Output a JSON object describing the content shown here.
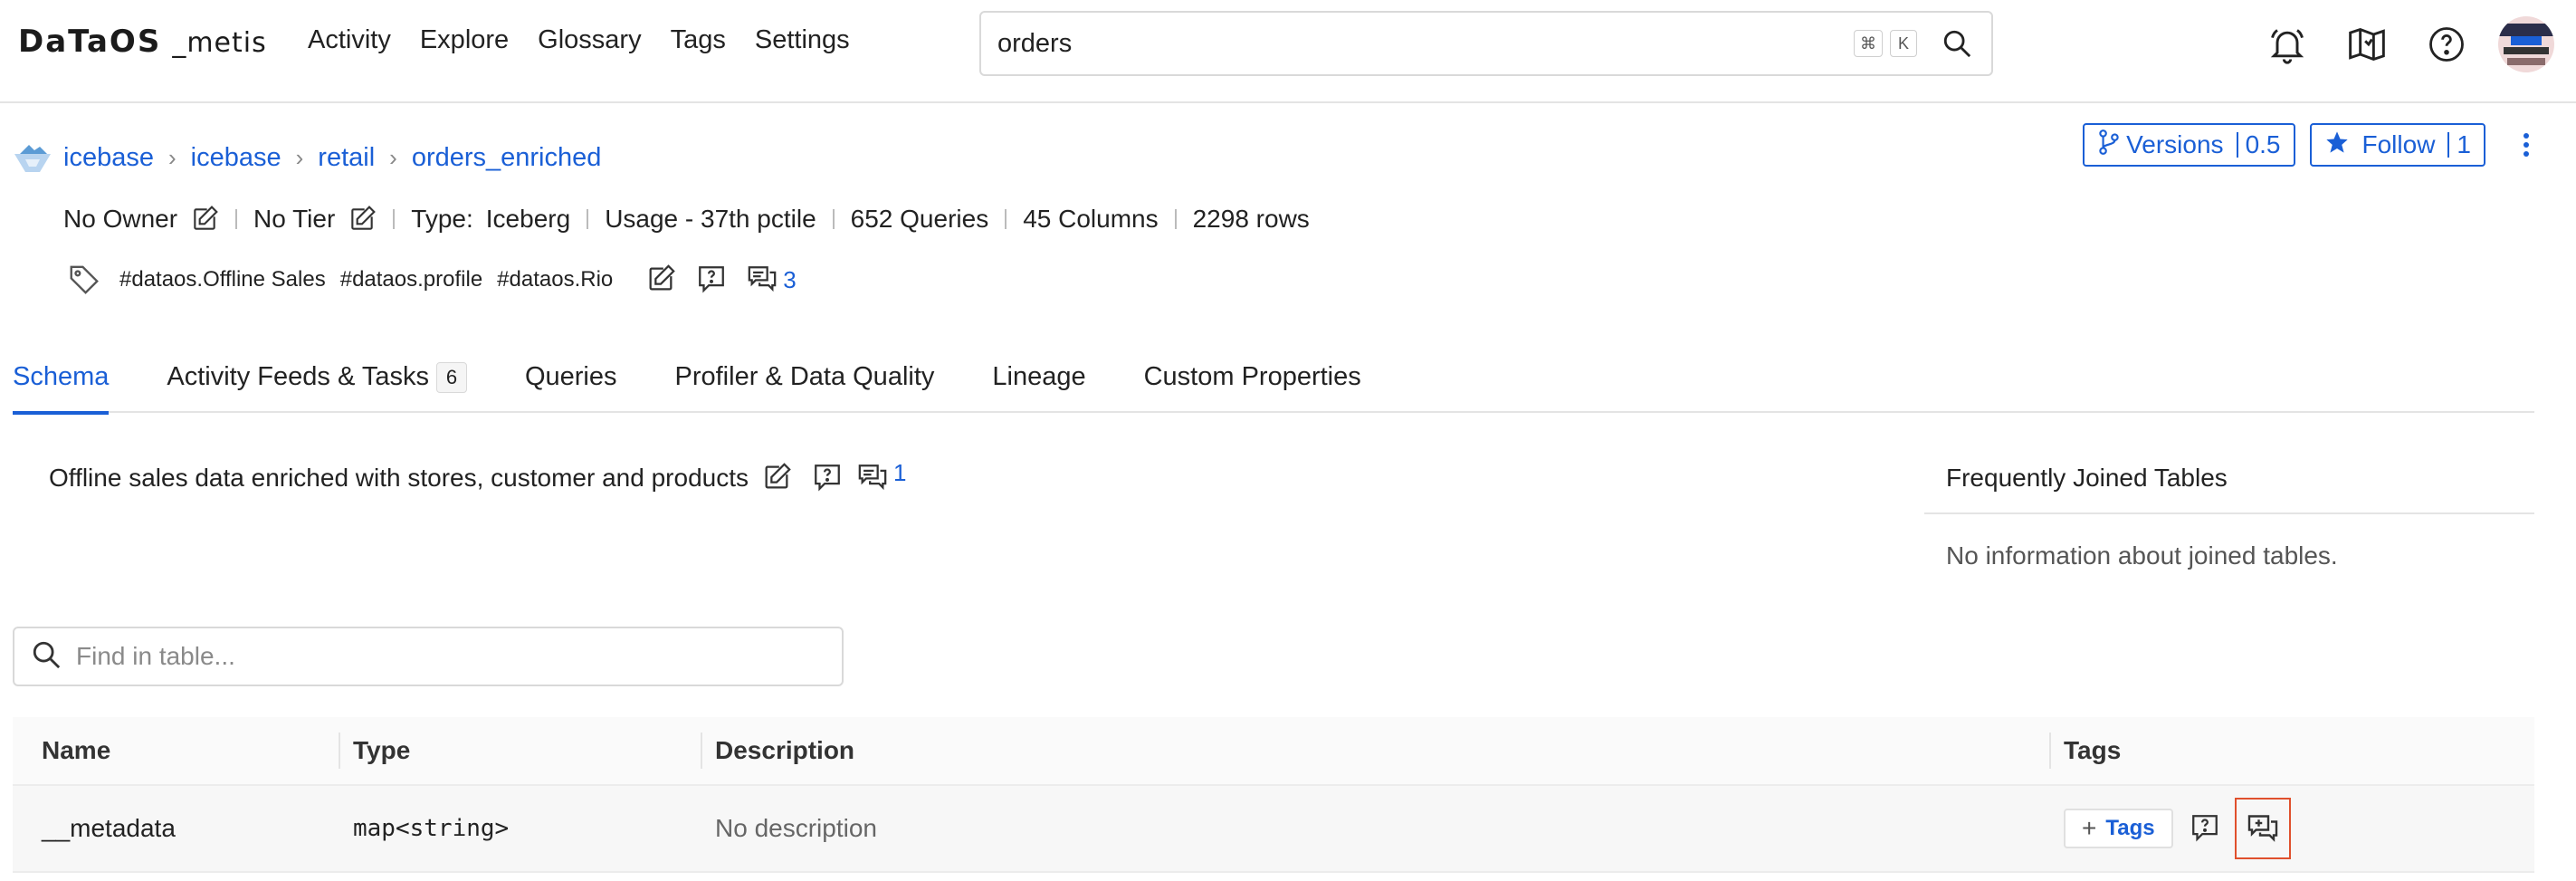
{
  "app": {
    "logo_main": "DaTaOS",
    "logo_sub": "_metis"
  },
  "nav": {
    "items": [
      "Activity",
      "Explore",
      "Glossary",
      "Tags",
      "Settings"
    ]
  },
  "search": {
    "value": "orders",
    "shortcut_cmd": "⌘",
    "shortcut_key": "K"
  },
  "breadcrumb": [
    "icebase",
    "icebase",
    "retail",
    "orders_enriched"
  ],
  "actions": {
    "versions_label": "Versions",
    "versions_value": "0.5",
    "follow_label": "Follow",
    "follow_count": "1"
  },
  "meta": {
    "owner": "No Owner",
    "tier": "No Tier",
    "type_label": "Type:",
    "type_value": "Iceberg",
    "usage": "Usage - 37th pctile",
    "queries": "652 Queries",
    "columns": "45 Columns",
    "rows": "2298 rows"
  },
  "tags": {
    "items": [
      "#dataos.Offline Sales",
      "#dataos.profile",
      "#dataos.Rio"
    ],
    "conversation_count": "3"
  },
  "tabs": [
    {
      "label": "Schema",
      "active": true
    },
    {
      "label": "Activity Feeds & Tasks",
      "badge": "6"
    },
    {
      "label": "Queries"
    },
    {
      "label": "Profiler & Data Quality"
    },
    {
      "label": "Lineage"
    },
    {
      "label": "Custom Properties"
    }
  ],
  "description": {
    "text": "Offline sales data enriched with stores, customer and products",
    "conversation_count": "1"
  },
  "joined_tables": {
    "title": "Frequently Joined Tables",
    "empty_text": "No information about joined tables."
  },
  "table_search": {
    "placeholder": "Find in table..."
  },
  "schema_table": {
    "headers": [
      "Name",
      "Type",
      "Description",
      "Tags"
    ],
    "rows": [
      {
        "name": "__metadata",
        "type": "map<string>",
        "description": "No description",
        "tags_button": "Tags"
      }
    ]
  },
  "colors": {
    "accent": "#1a5fd6",
    "highlight_box": "#e0502d"
  }
}
